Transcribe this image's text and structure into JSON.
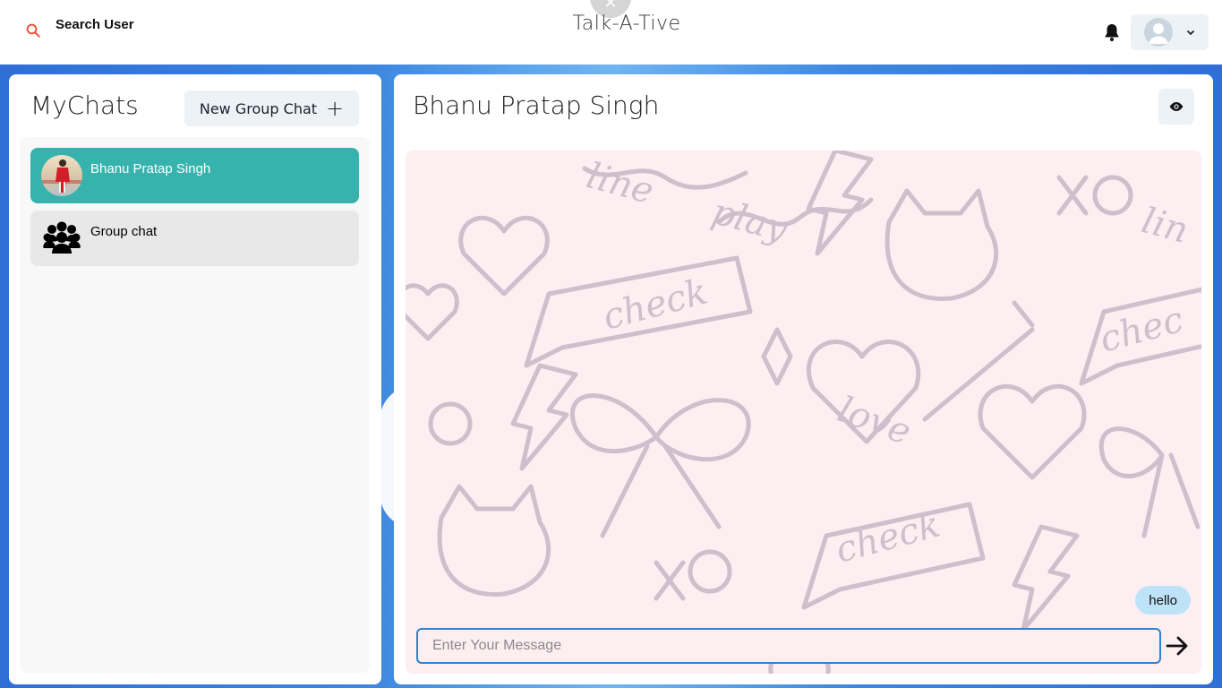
{
  "header": {
    "search_label": "Search User",
    "app_title": "Talk-A-Tive"
  },
  "left": {
    "title": "MyChats",
    "new_group_label": "New Group Chat",
    "chats": [
      {
        "name": "Bhanu Pratap Singh",
        "active": true
      },
      {
        "name": "Group chat",
        "active": false
      }
    ]
  },
  "right": {
    "chat_title": "Bhanu Pratap Singh",
    "messages": [
      {
        "text": "hello",
        "from_me": true
      }
    ],
    "input_placeholder": "Enter Your Message",
    "input_value": ""
  },
  "colors": {
    "active_chat": "#38b2ac",
    "message_bubble": "#bee3f8",
    "input_border": "#3182ce",
    "search_icon": "#e53e3e"
  }
}
